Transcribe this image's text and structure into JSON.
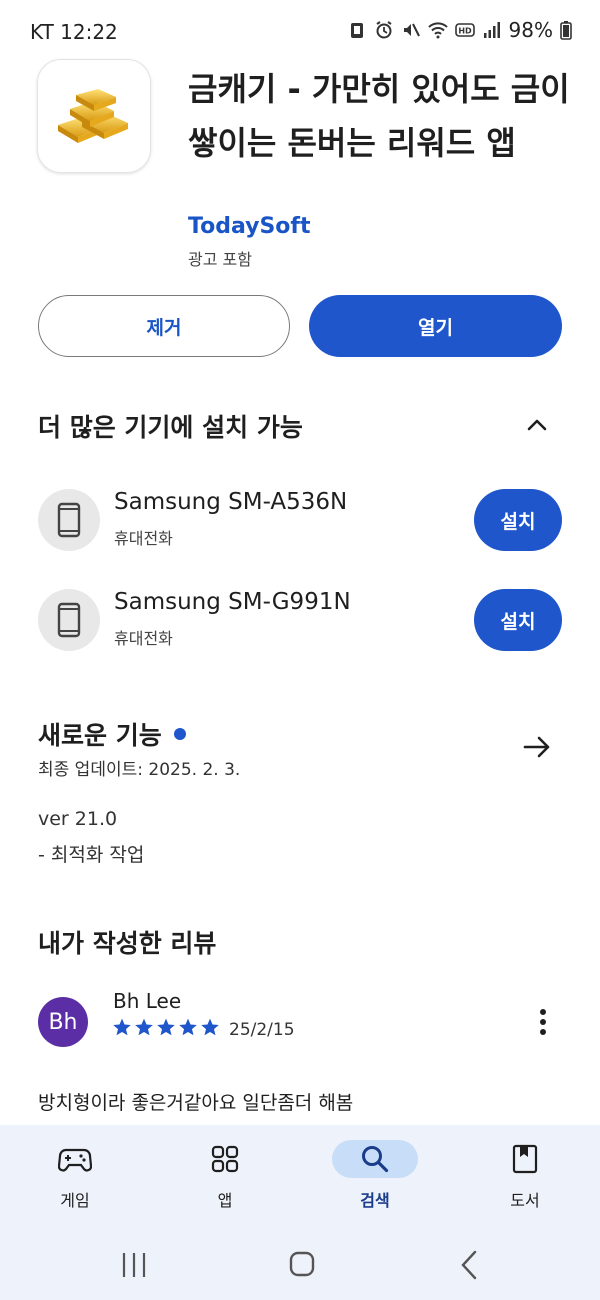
{
  "status_bar": {
    "carrier_time": "KT 12:22",
    "battery": "98%"
  },
  "app": {
    "title": "금캐기 - 가만히 있어도 금이 쌓이는 돈버는 리워드 앱",
    "developer": "TodaySoft",
    "ads_label": "광고 포함",
    "icon": "gold-bars-icon"
  },
  "actions": {
    "remove_label": "제거",
    "open_label": "열기"
  },
  "devices": {
    "title": "더 많은 기기에 설치 가능",
    "items": [
      {
        "name": "Samsung SM-A536N",
        "type": "휴대전화",
        "install_label": "설치"
      },
      {
        "name": "Samsung SM-G991N",
        "type": "휴대전화",
        "install_label": "설치"
      }
    ]
  },
  "whats_new": {
    "title": "새로운 기능",
    "updated": "최종 업데이트: 2025. 2. 3.",
    "notes": [
      "ver 21.0",
      "- 최적화 작업"
    ]
  },
  "my_review": {
    "title": "내가 작성한 리뷰",
    "avatar_initials": "Bh",
    "reviewer": "Bh Lee",
    "rating": 5,
    "date": "25/2/15",
    "text": "방치형이라 좋은거같아요 일단좀더 해봄"
  },
  "bottom_nav": {
    "items": [
      {
        "label": "게임",
        "icon": "gamepad-icon",
        "active": false
      },
      {
        "label": "앱",
        "icon": "apps-grid-icon",
        "active": false
      },
      {
        "label": "검색",
        "icon": "search-icon",
        "active": true
      },
      {
        "label": "도서",
        "icon": "bookmark-book-icon",
        "active": false
      }
    ]
  },
  "colors": {
    "accent": "#2056cc",
    "link": "#1a55c8",
    "avatar": "#5b2ea6",
    "nav_bg": "#eef2fa",
    "nav_active_pill": "#c8def8"
  }
}
